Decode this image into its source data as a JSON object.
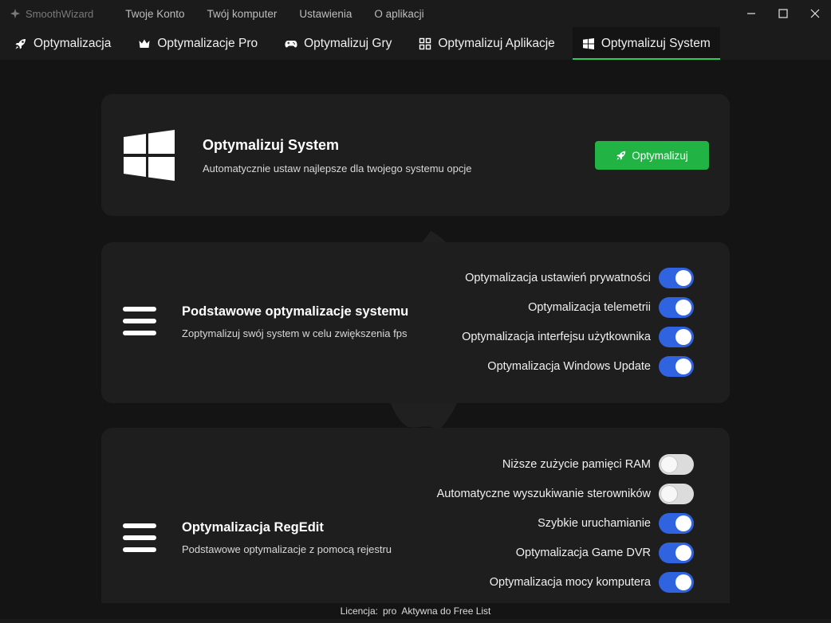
{
  "app": {
    "title": "SmoothWizard"
  },
  "menu": {
    "items": [
      "Twoje Konto",
      "Twój komputer",
      "Ustawienia",
      "O aplikacji"
    ]
  },
  "tabs": [
    {
      "label": "Optymalizacja",
      "icon": "rocket-icon"
    },
    {
      "label": "Optymalizacje Pro",
      "icon": "crown-icon"
    },
    {
      "label": "Optymalizuj Gry",
      "icon": "gamepad-icon"
    },
    {
      "label": "Optymalizuj Aplikacje",
      "icon": "grid-icon"
    },
    {
      "label": "Optymalizuj System",
      "icon": "windows-icon",
      "active": true
    }
  ],
  "system_card": {
    "title": "Optymalizuj System",
    "description": "Automatycznie ustaw najlepsze dla twojego systemu opcje",
    "button_label": "Optymalizuj"
  },
  "basic_card": {
    "title": "Podstawowe optymalizacje systemu",
    "description": "Zoptymalizuj swój system w celu zwiększenia fps",
    "toggles": [
      {
        "label": "Optymalizacja ustawień prywatności",
        "on": true
      },
      {
        "label": "Optymalizacja telemetrii",
        "on": true
      },
      {
        "label": "Optymalizacja interfejsu użytkownika",
        "on": true
      },
      {
        "label": "Optymalizacja Windows Update",
        "on": true
      }
    ]
  },
  "regedit_card": {
    "title": "Optymalizacja RegEdit",
    "description": "Podstawowe optymalizacje z pomocą rejestru",
    "toggles": [
      {
        "label": "Niższe zużycie pamięci RAM",
        "on": false
      },
      {
        "label": "Automatyczne wyszukiwanie sterowników",
        "on": false
      },
      {
        "label": "Szybkie uruchamianie",
        "on": true
      },
      {
        "label": "Optymalizacja Game DVR",
        "on": true
      },
      {
        "label": "Optymalizacja mocy komputera",
        "on": true
      }
    ]
  },
  "status": {
    "license_label": "Licencja:",
    "license_value": "pro",
    "active_text": "Aktywna do Free List"
  },
  "colors": {
    "accent_green": "#22b345",
    "toggle_blue": "#2f63e0",
    "background": "#141414",
    "card": "#1e1e1e"
  }
}
